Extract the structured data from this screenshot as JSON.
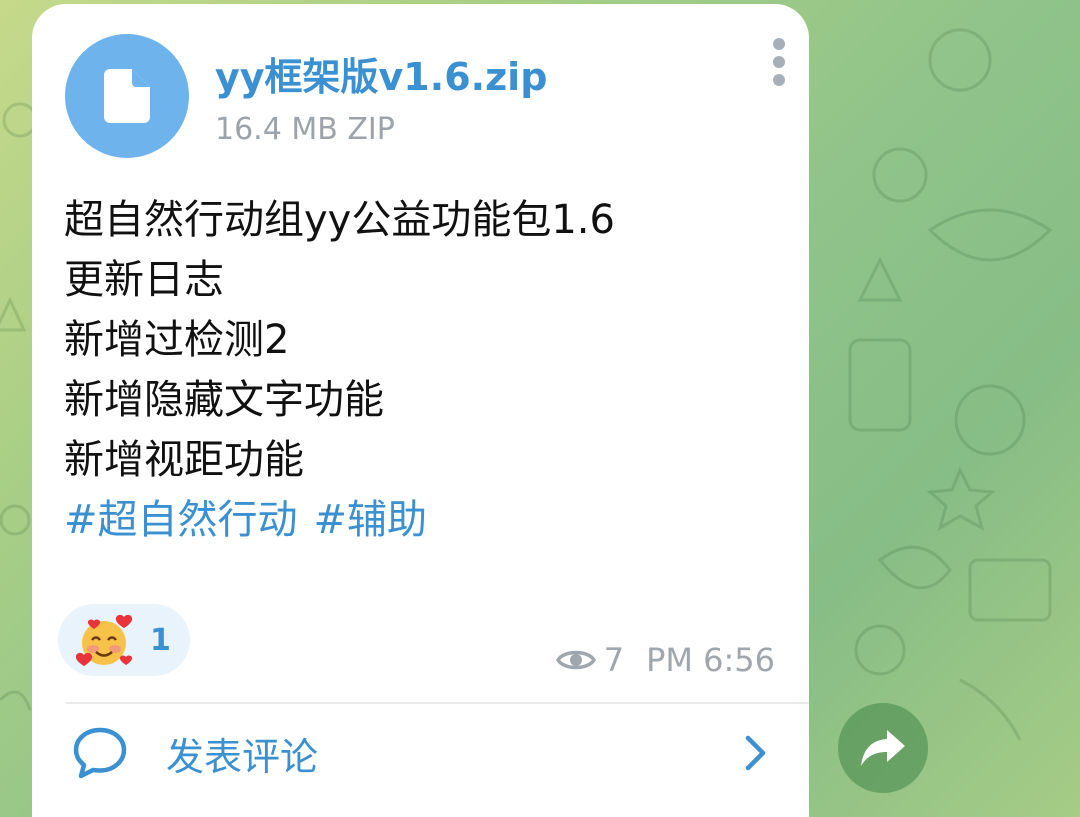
{
  "message": {
    "file": {
      "name": "yy框架版v1.6.zip",
      "meta": "16.4 MB ZIP",
      "icon": "file-icon"
    },
    "caption_lines": [
      "超自然行动组yy公益功能包1.6",
      "更新日志",
      "新增过检测2",
      "新增隐藏文字功能",
      "新增视距功能"
    ],
    "hashtags": [
      "#超自然行动",
      "#辅助"
    ],
    "reaction": {
      "emoji": "smiling-face-with-hearts",
      "count": "1"
    },
    "views": "7",
    "time": "PM 6:56"
  },
  "comments": {
    "label": "发表评论",
    "icon": "comment-bubble-icon"
  },
  "colors": {
    "accent": "#3a90d1",
    "file_icon_bg": "#6fb3ec",
    "meta_gray": "#a0a6ad",
    "share_bg": "#5a965a"
  }
}
